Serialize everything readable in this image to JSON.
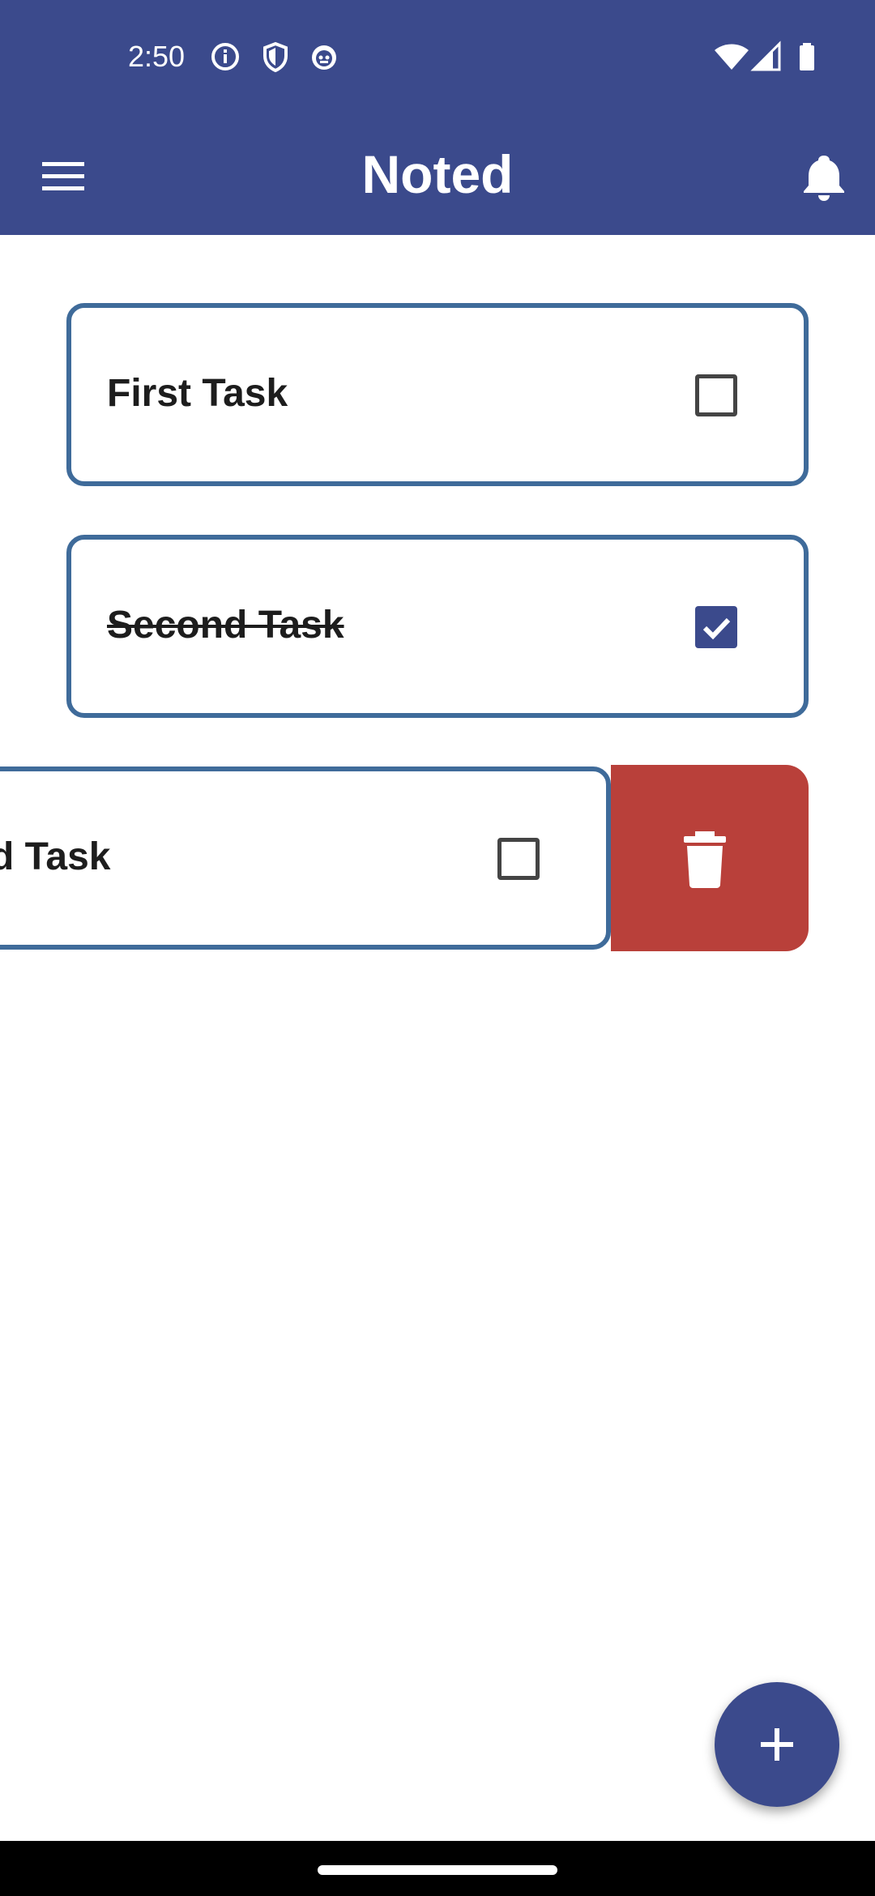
{
  "status_bar": {
    "time": "2:50",
    "icons": [
      "info-icon",
      "shield-icon",
      "robot-icon",
      "wifi-icon",
      "signal-icon",
      "battery-icon"
    ]
  },
  "app_bar": {
    "title": "Noted",
    "menu_icon": "hamburger-menu-icon",
    "notification_icon": "bell-icon"
  },
  "tasks": [
    {
      "label": "First Task",
      "checked": false
    },
    {
      "label": "Second Task",
      "checked": true
    },
    {
      "label": "d Task",
      "checked": false,
      "swiped": true
    }
  ],
  "swipe_action": {
    "icon": "trash-icon"
  },
  "fab": {
    "icon": "plus-icon"
  },
  "colors": {
    "primary": "#3b4a8c",
    "card_border": "#3f6b9a",
    "delete": "#b9403a",
    "background": "#ffffff"
  }
}
